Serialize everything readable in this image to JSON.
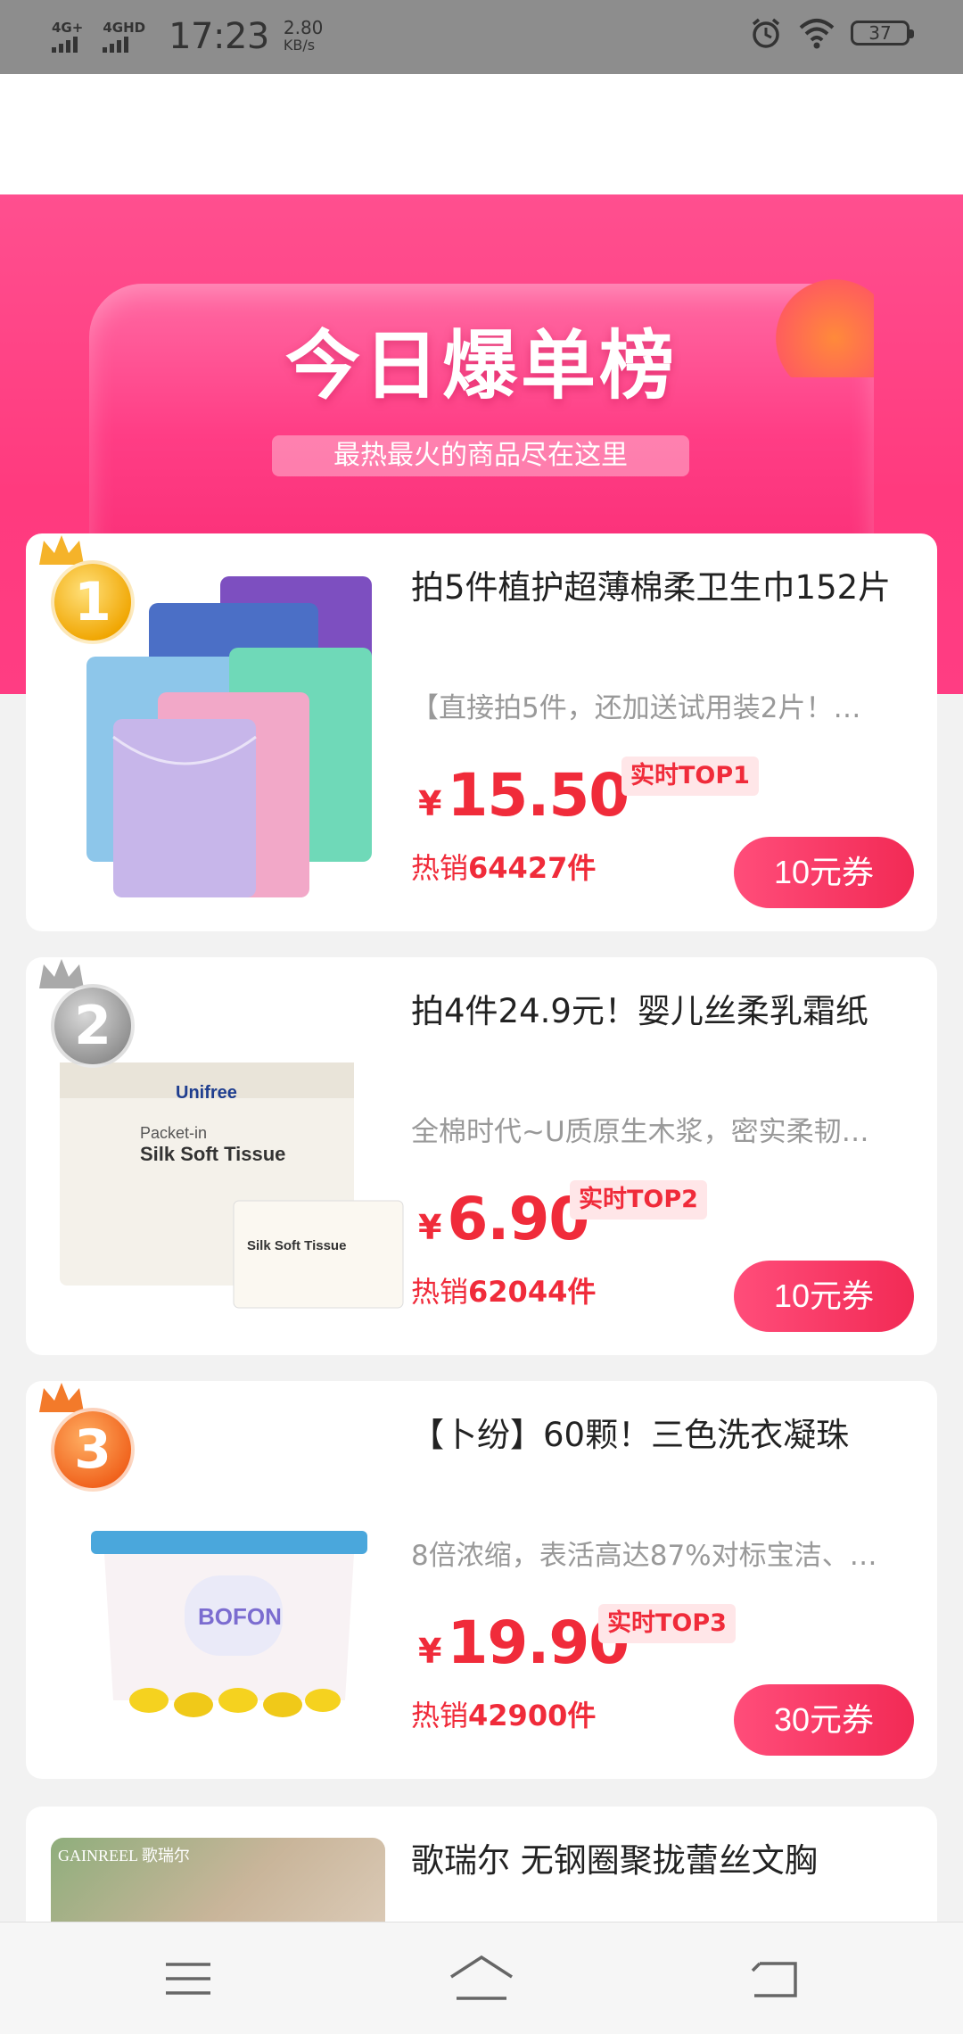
{
  "status_bar": {
    "net1": "4G+",
    "net2": "4GHD",
    "time": "17:23",
    "speed_value": "2.80",
    "speed_unit": "KB/s",
    "battery": "37"
  },
  "banner": {
    "title": "今日爆单榜",
    "subtitle": "最热最火的商品尽在这里"
  },
  "products": [
    {
      "rank": "1",
      "title": "拍5件植护超薄棉柔卫生巾152片",
      "desc": "【直接拍5件，还加送试用装2片！…",
      "price_symbol": "¥",
      "price": "15.50",
      "badge": "实时TOP1",
      "sold_prefix": "热销",
      "sold_count": "64427件",
      "coupon": "10元券"
    },
    {
      "rank": "2",
      "title": "拍4件24.9元！婴儿丝柔乳霜纸",
      "desc": "全棉时代~U质原生木浆，密实柔韧…",
      "price_symbol": "¥",
      "price": "6.90",
      "badge": "实时TOP2",
      "sold_prefix": "热销",
      "sold_count": "62044件",
      "coupon": "10元券"
    },
    {
      "rank": "3",
      "title": "【卜纷】60颗！三色洗衣凝珠",
      "desc": "8倍浓缩，表活高达87%对标宝洁、…",
      "price_symbol": "¥",
      "price": "19.90",
      "badge": "实时TOP3",
      "sold_prefix": "热销",
      "sold_count": "42900件",
      "coupon": "30元券"
    },
    {
      "title": "歌瑞尔 无钢圈聚拢蕾丝文胸",
      "brand_text": "GAINREEL 歌瑞尔"
    }
  ],
  "nav": {
    "menu_icon": "menu-icon",
    "home_icon": "home-icon",
    "back_icon": "back-icon"
  }
}
